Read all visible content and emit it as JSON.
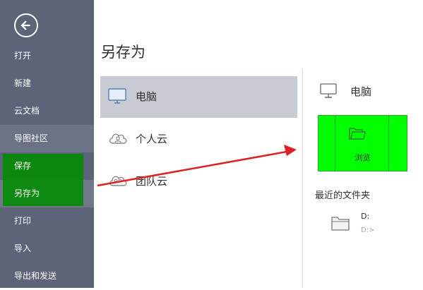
{
  "sidebar": {
    "items": [
      {
        "label": "打开"
      },
      {
        "label": "新建"
      },
      {
        "label": "云文档"
      },
      {
        "label": "导图社区"
      },
      {
        "label": "保存"
      },
      {
        "label": "另存为"
      },
      {
        "label": "打印"
      },
      {
        "label": "导入"
      },
      {
        "label": "导出和发送"
      }
    ]
  },
  "main": {
    "title": "另存为",
    "places": [
      {
        "label": "电脑",
        "icon": "monitor-icon"
      },
      {
        "label": "个人云",
        "icon": "cloud-icon"
      },
      {
        "label": "团队云",
        "icon": "cloud-icon"
      }
    ]
  },
  "right": {
    "heading": "电脑",
    "browse_label": "浏览",
    "recent_title": "最近的文件夹",
    "recent": [
      {
        "name": "D:",
        "path": "D:>"
      }
    ]
  },
  "colors": {
    "sidebar_bg": "#5e6477",
    "selected_place_bg": "#c8cbd3",
    "highlight_green": "#00ff00",
    "arrow_red": "#e02020"
  }
}
